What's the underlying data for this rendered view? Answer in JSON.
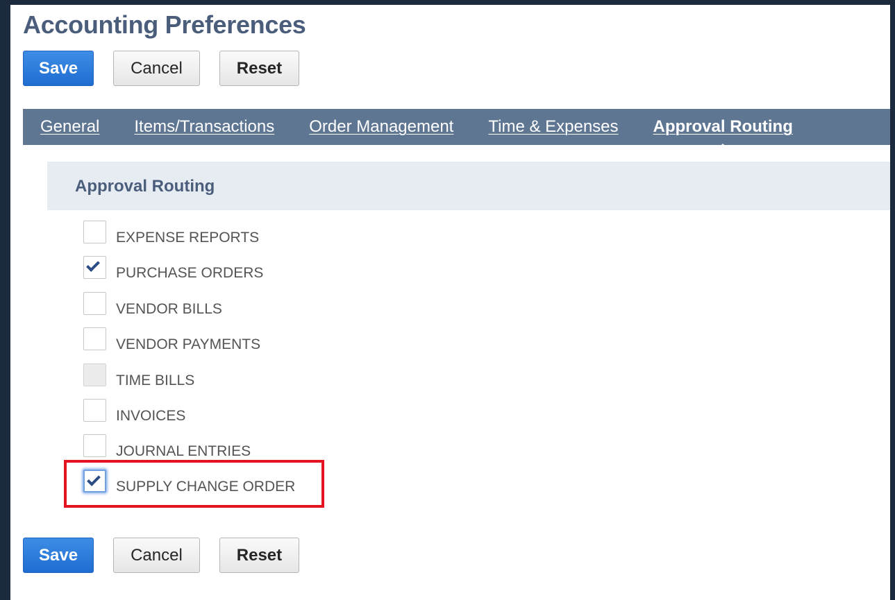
{
  "page": {
    "title": "Accounting Preferences"
  },
  "actions_top": {
    "save": "Save",
    "cancel": "Cancel",
    "reset": "Reset"
  },
  "actions_bottom": {
    "save": "Save",
    "cancel": "Cancel",
    "reset": "Reset"
  },
  "tabs": [
    {
      "label": "General",
      "active": false
    },
    {
      "label": "Items/Transactions",
      "active": false
    },
    {
      "label": "Order Management",
      "active": false
    },
    {
      "label": "Time & Expenses",
      "active": false
    },
    {
      "label": "Approval Routing",
      "active": true
    }
  ],
  "section": {
    "title": "Approval Routing"
  },
  "options": [
    {
      "label": "EXPENSE REPORTS",
      "checked": false,
      "disabled": false
    },
    {
      "label": "PURCHASE ORDERS",
      "checked": true,
      "disabled": false
    },
    {
      "label": "VENDOR BILLS",
      "checked": false,
      "disabled": false
    },
    {
      "label": "VENDOR PAYMENTS",
      "checked": false,
      "disabled": false
    },
    {
      "label": "TIME BILLS",
      "checked": false,
      "disabled": true
    },
    {
      "label": "INVOICES",
      "checked": false,
      "disabled": false
    },
    {
      "label": "JOURNAL ENTRIES",
      "checked": false,
      "disabled": false
    },
    {
      "label": "SUPPLY CHANGE ORDER",
      "checked": true,
      "disabled": false,
      "focused": true
    }
  ],
  "colors": {
    "outer_background": "#1b2b3d",
    "title_text": "#4a5e7c",
    "primary_button": "#2a7de1",
    "tab_bar": "#5f7693",
    "section_header_bg": "#e7ecf3",
    "checkmark": "#2c4c86",
    "highlight_border": "#e3141f"
  }
}
